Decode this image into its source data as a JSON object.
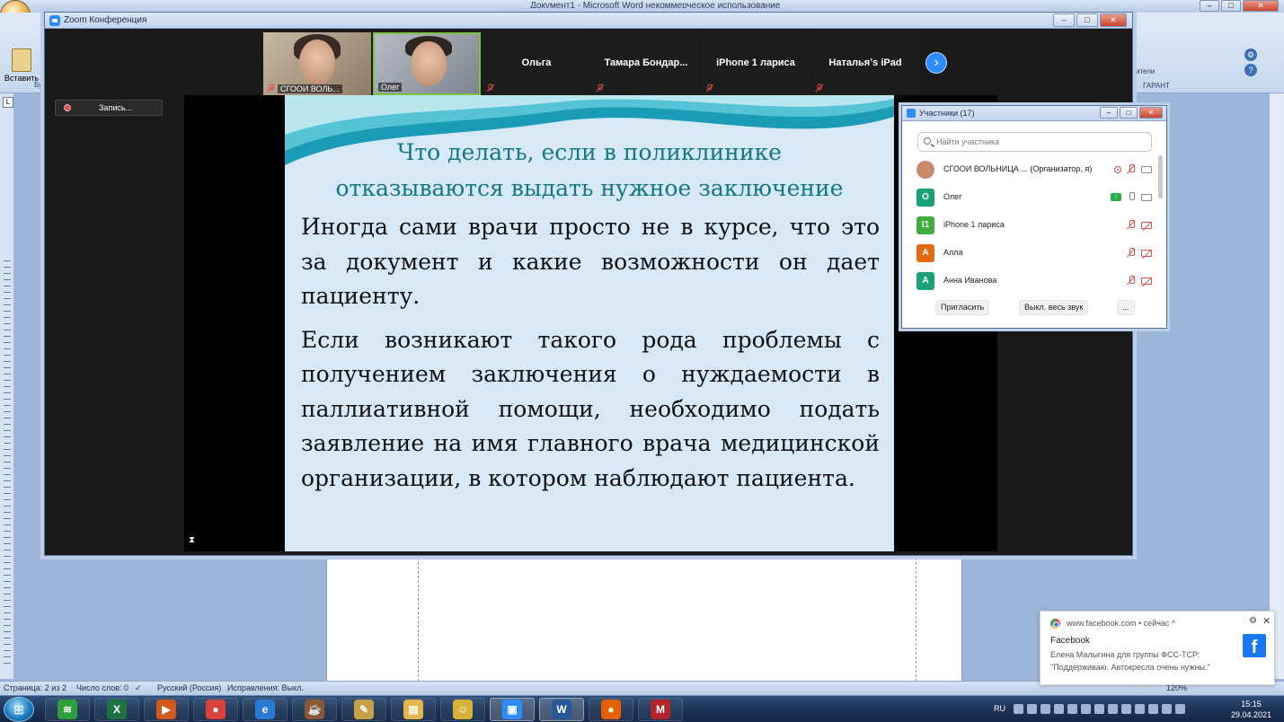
{
  "word": {
    "title": "Документ1 - Microsoft Word некоммерческое использование",
    "paste_label": "Вставить",
    "ribbon_fragment_left": "Бу",
    "ribbon_fragment_right": "ители",
    "ribbon_group_garant": "ГАРАНТ",
    "ruler_tab": "L",
    "status": {
      "page": "Страница: 2 из 2",
      "words": "Число слов: 0",
      "language": "Русский (Россия)",
      "revisions": "Исправления: Выкл.",
      "zoom": "120%"
    }
  },
  "zoom": {
    "window_title": "Zoom Конференция",
    "recording_label": "Запись...",
    "gallery": [
      {
        "name": "СГООИ ВОЛЬ...",
        "kind": "camera",
        "muted": true
      },
      {
        "name": "Олег",
        "kind": "camera",
        "muted": false
      },
      {
        "name": "Ольга",
        "kind": "name",
        "muted": true
      },
      {
        "name": "Тамара  Бондар...",
        "kind": "name",
        "muted": true
      },
      {
        "name": "iPhone 1 лариса",
        "kind": "name",
        "muted": true
      },
      {
        "name": "Натальяʼs iPad",
        "kind": "name",
        "muted": true
      }
    ],
    "next_page_icon": "chevron-right-icon",
    "slide": {
      "title_line1": "Что делать, если в поликлинике",
      "title_line2": "отказываются выдать нужное заключение",
      "paragraph1": "Иногда сами врачи просто не в курсе, что это за документ и какие возможности он дает пациенту.",
      "paragraph2": "Если возникают такого рода проблемы с получением заключения о нуждаемости в паллиативной помощи, необходимо подать заявление на имя главного врача медицинской организации, в котором наблюдают пациента."
    }
  },
  "participants": {
    "title": "Участники (17)",
    "search_placeholder": "Найти участника",
    "list": [
      {
        "initials": "",
        "name": "СГООИ ВОЛЬНИЦА ... (Организатор, я)",
        "color": "#c98a6a",
        "recording": true,
        "mic": "off",
        "cam": "on",
        "sharing": false
      },
      {
        "initials": "О",
        "name": "Олег",
        "color": "#1aa179",
        "recording": false,
        "mic": "on",
        "cam": "on",
        "sharing": true
      },
      {
        "initials": "I1",
        "name": "iPhone 1 лариса",
        "color": "#3fae3f",
        "recording": false,
        "mic": "off",
        "cam": "off",
        "sharing": false
      },
      {
        "initials": "А",
        "name": "Алла",
        "color": "#e36a12",
        "recording": false,
        "mic": "off",
        "cam": "off",
        "sharing": false
      },
      {
        "initials": "А",
        "name": "Анна Иванова",
        "color": "#1aa179",
        "recording": false,
        "mic": "off",
        "cam": "off",
        "sharing": false
      }
    ],
    "invite_label": "Пригласить",
    "mute_all_label": "Выкл. весь звук",
    "more_label": "..."
  },
  "notification": {
    "source": "www.facebook.com • сейчас ^",
    "title": "Facebook",
    "line1": "Елена Малыгина для группы ФСС-ТСР:",
    "line2": "\"Поддерживаю. Автокресла очень нужны.\"",
    "icon": "facebook-icon"
  },
  "taskbar": {
    "language": "RU",
    "time": "15:15",
    "date": "29.04.2021",
    "apps": [
      {
        "name": "wifi-app-icon",
        "color": "#2f9e3c",
        "glyph": "≋"
      },
      {
        "name": "excel-icon",
        "color": "#1f7244",
        "glyph": "X"
      },
      {
        "name": "media-player-icon",
        "color": "#d35a1e",
        "glyph": "▶"
      },
      {
        "name": "chrome-icon",
        "color": "#d9423a",
        "glyph": "●"
      },
      {
        "name": "internet-explorer-icon",
        "color": "#2a7bd4",
        "glyph": "e"
      },
      {
        "name": "coffee-cup-icon",
        "color": "#8a5a34",
        "glyph": "☕"
      },
      {
        "name": "paint-icon",
        "color": "#c8a048",
        "glyph": "✎"
      },
      {
        "name": "folder-icon",
        "color": "#e2b64a",
        "glyph": "▤"
      },
      {
        "name": "smiley-app-icon",
        "color": "#d7b23a",
        "glyph": "☺"
      },
      {
        "name": "zoom-app-icon",
        "color": "#2d8cff",
        "glyph": "▣"
      },
      {
        "name": "word-icon",
        "color": "#2b579a",
        "glyph": "W"
      },
      {
        "name": "firefox-icon",
        "color": "#e66000",
        "glyph": "●"
      },
      {
        "name": "antivirus-icon",
        "color": "#b3242a",
        "glyph": "M"
      }
    ]
  }
}
